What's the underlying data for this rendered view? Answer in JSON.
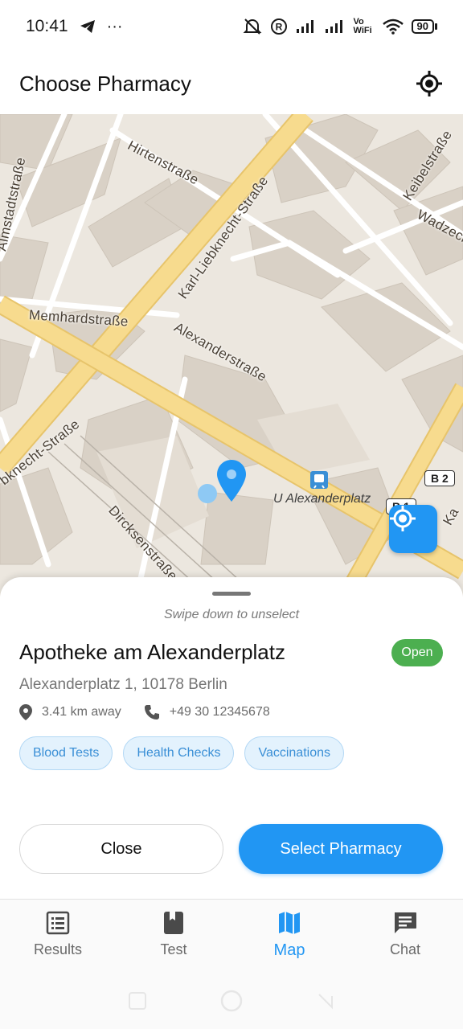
{
  "status_bar": {
    "time": "10:41",
    "dots": "···",
    "battery": "90",
    "network_label": "Vo WiFi"
  },
  "app_bar": {
    "title": "Choose Pharmacy"
  },
  "map": {
    "streets": [
      "Hirtenstraße",
      "Karl-Liebknecht-Straße",
      "Keibelstraße",
      "Wadzeck",
      "Almstadtstraße",
      "Memhardstraße",
      "Alexanderstraße",
      "bknecht-Straße",
      "Dircksenstraße",
      "Ka"
    ],
    "road_shields": [
      "B 2",
      "B 1"
    ],
    "station": "U Alexanderplatz"
  },
  "sheet": {
    "hint": "Swipe down to unselect",
    "name": "Apotheke am Alexanderplatz",
    "status": "Open",
    "address": "Alexanderplatz 1, 10178 Berlin",
    "distance": "3.41 km away",
    "phone": "+49 30 12345678",
    "tags": [
      "Blood Tests",
      "Health Checks",
      "Vaccinations"
    ],
    "close_label": "Close",
    "select_label": "Select Pharmacy"
  },
  "nav": {
    "items": [
      {
        "label": "Results",
        "icon": "list-icon"
      },
      {
        "label": "Test",
        "icon": "book-icon"
      },
      {
        "label": "Map",
        "icon": "map-icon"
      },
      {
        "label": "Chat",
        "icon": "chat-icon"
      }
    ],
    "active": "Map"
  },
  "colors": {
    "accent": "#2196F3",
    "open": "#4CAF50",
    "road": "#f6d98c"
  }
}
